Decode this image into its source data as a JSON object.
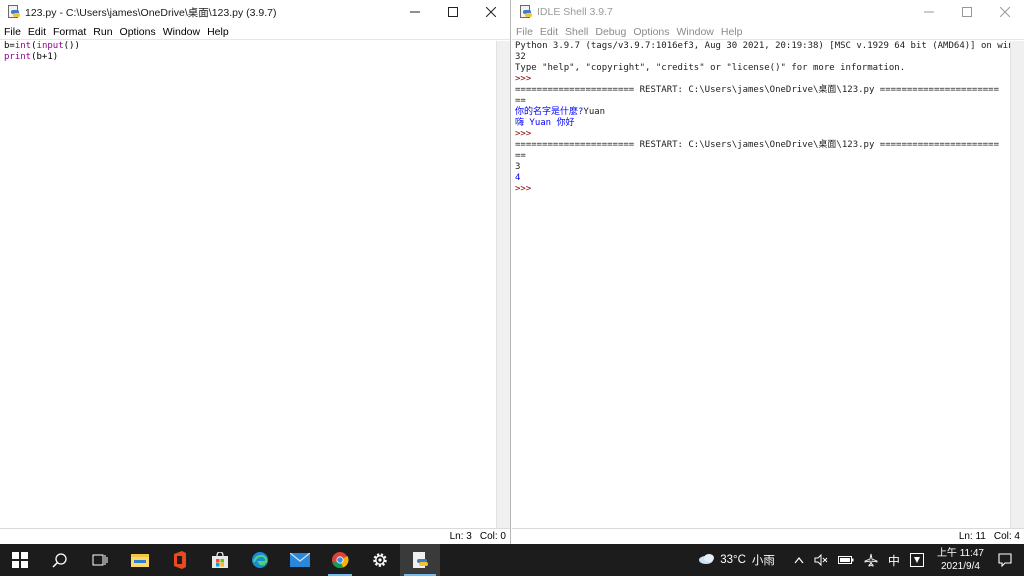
{
  "editor_window": {
    "title": "123.py - C:\\Users\\james\\OneDrive\\桌面\\123.py (3.9.7)",
    "menu": [
      "File",
      "Edit",
      "Format",
      "Run",
      "Options",
      "Window",
      "Help"
    ],
    "code": [
      [
        {
          "t": "b=",
          "c": "black"
        },
        {
          "t": "int",
          "c": "builtin"
        },
        {
          "t": "(",
          "c": "black"
        },
        {
          "t": "input",
          "c": "builtin"
        },
        {
          "t": "())",
          "c": "black"
        }
      ],
      [
        {
          "t": "print",
          "c": "builtin"
        },
        {
          "t": "(b+1)",
          "c": "black"
        }
      ]
    ],
    "status": {
      "ln": "Ln: 3",
      "col": "Col: 0"
    }
  },
  "shell_window": {
    "title": "IDLE Shell 3.9.7",
    "menu": [
      "File",
      "Edit",
      "Shell",
      "Debug",
      "Options",
      "Window",
      "Help"
    ],
    "lines": [
      [
        {
          "t": "Python 3.9.7 (tags/v3.9.7:1016ef3, Aug 30 2021, 20:19:38) [MSC v.1929 64 bit (AMD64)] on win",
          "c": "shell"
        }
      ],
      [
        {
          "t": "32",
          "c": "shell"
        }
      ],
      [
        {
          "t": "Type \"help\", \"copyright\", \"credits\" or \"license()\" for more information.",
          "c": "shell"
        }
      ],
      [
        {
          "t": ">>> ",
          "c": "prompt"
        }
      ],
      [
        {
          "t": "====================== RESTART: C:\\Users\\james\\OneDrive\\桌面\\123.py ======================",
          "c": "shell"
        }
      ],
      [
        {
          "t": "==",
          "c": "shell"
        }
      ],
      [
        {
          "t": "你的名字是什麼?",
          "c": "out"
        },
        {
          "t": "Yuan",
          "c": "shell"
        }
      ],
      [
        {
          "t": "嗨 Yuan 你好",
          "c": "out"
        }
      ],
      [
        {
          "t": ">>> ",
          "c": "prompt"
        }
      ],
      [
        {
          "t": "====================== RESTART: C:\\Users\\james\\OneDrive\\桌面\\123.py ======================",
          "c": "shell"
        }
      ],
      [
        {
          "t": "==",
          "c": "shell"
        }
      ],
      [
        {
          "t": "3",
          "c": "shell"
        }
      ],
      [
        {
          "t": "4",
          "c": "out"
        }
      ],
      [
        {
          "t": ">>> ",
          "c": "prompt"
        }
      ]
    ],
    "status": {
      "ln": "Ln: 11",
      "col": "Col: 4"
    }
  },
  "taskbar": {
    "apps": [
      "start-icon",
      "search-icon",
      "task-view-icon",
      "file-explorer-icon",
      "office-icon",
      "store-icon",
      "edge-icon",
      "mail-icon",
      "chrome-icon",
      "settings-icon",
      "idle-icon"
    ],
    "weather": {
      "temp": "33°C",
      "condition": "小雨"
    },
    "ime": "中",
    "clock": {
      "time": "上午 11:47",
      "date": "2021/9/4"
    }
  },
  "colors": {
    "builtin": "#900090",
    "output": "#0000ff",
    "prompt": "#8b0000",
    "taskbar": "#1c1c1c"
  }
}
